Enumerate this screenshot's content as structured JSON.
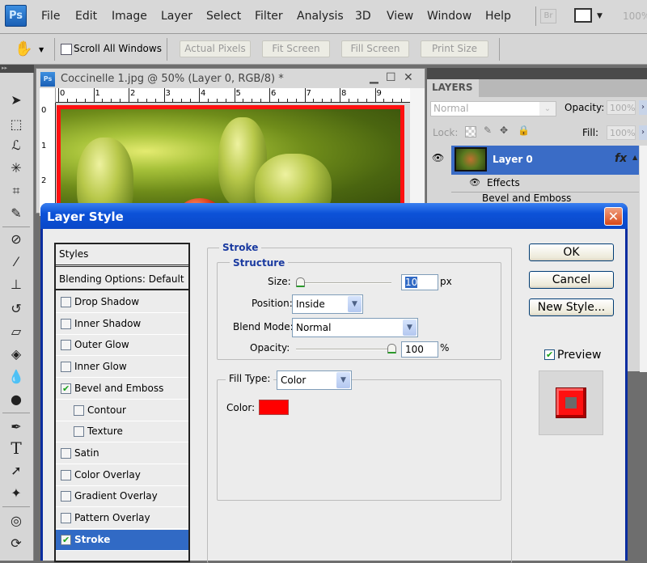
{
  "menubar": {
    "logo": "Ps",
    "items": [
      "File",
      "Edit",
      "Image",
      "Layer",
      "Select",
      "Filter",
      "Analysis",
      "3D",
      "View",
      "Window",
      "Help"
    ],
    "bridge_button": "Br",
    "zoom_level": "100%"
  },
  "options_bar": {
    "scroll_all_windows": {
      "label": "Scroll All Windows",
      "checked": false
    },
    "buttons": [
      "Actual Pixels",
      "Fit Screen",
      "Fill Screen",
      "Print Size"
    ]
  },
  "toolbar": {
    "tools": [
      "move-tool",
      "rectangular-marquee-tool",
      "lasso-tool",
      "magic-wand-tool",
      "crop-tool",
      "eyedropper-tool",
      "spot-healing-brush-tool",
      "brush-tool",
      "clone-stamp-tool",
      "history-brush-tool",
      "eraser-tool",
      "paint-bucket-tool",
      "blur-tool",
      "dodge-tool",
      "pen-tool",
      "type-tool",
      "path-selection-tool",
      "custom-shape-tool",
      "3d-rotate-tool",
      "3d-orbit-tool"
    ]
  },
  "document": {
    "title": "Coccinelle 1.jpg @ 50% (Layer 0, RGB/8) *",
    "ruler_top": [
      "0",
      "1",
      "2",
      "3",
      "4",
      "5",
      "6",
      "7",
      "8",
      "9"
    ],
    "ruler_left": [
      "0",
      "1",
      "2"
    ],
    "stroke_color": "#ff1010"
  },
  "layers_panel": {
    "tab": "LAYERS",
    "blend_mode": "Normal",
    "opacity_label": "Opacity:",
    "opacity_value": "100%",
    "lock_label": "Lock:",
    "fill_label": "Fill:",
    "fill_value": "100%",
    "layer_name": "Layer 0",
    "fx": "fx",
    "effects_label": "Effects",
    "effect_item": "Bevel and Emboss"
  },
  "dialog": {
    "title": "Layer Style",
    "styles_header": "Styles",
    "blending_options": "Blending Options: Default",
    "styles": [
      {
        "label": "Drop Shadow",
        "checked": false,
        "indent": false,
        "selected": false
      },
      {
        "label": "Inner Shadow",
        "checked": false,
        "indent": false,
        "selected": false
      },
      {
        "label": "Outer Glow",
        "checked": false,
        "indent": false,
        "selected": false
      },
      {
        "label": "Inner Glow",
        "checked": false,
        "indent": false,
        "selected": false
      },
      {
        "label": "Bevel and Emboss",
        "checked": true,
        "indent": false,
        "selected": false
      },
      {
        "label": "Contour",
        "checked": false,
        "indent": true,
        "selected": false
      },
      {
        "label": "Texture",
        "checked": false,
        "indent": true,
        "selected": false
      },
      {
        "label": "Satin",
        "checked": false,
        "indent": false,
        "selected": false
      },
      {
        "label": "Color Overlay",
        "checked": false,
        "indent": false,
        "selected": false
      },
      {
        "label": "Gradient Overlay",
        "checked": false,
        "indent": false,
        "selected": false
      },
      {
        "label": "Pattern Overlay",
        "checked": false,
        "indent": false,
        "selected": false
      },
      {
        "label": "Stroke",
        "checked": true,
        "indent": false,
        "selected": true
      }
    ],
    "stroke": {
      "group_label": "Stroke",
      "structure_label": "Structure",
      "size_label": "Size:",
      "size_value": "10",
      "size_unit": "px",
      "size_slider_fraction": 0.04,
      "position_label": "Position:",
      "position_value": "Inside",
      "blend_mode_label": "Blend Mode:",
      "blend_mode_value": "Normal",
      "opacity_label": "Opacity:",
      "opacity_value": "100",
      "opacity_unit": "%",
      "opacity_slider_fraction": 1.0,
      "fill_type_label": "Fill Type:",
      "fill_type_value": "Color",
      "color_label": "Color:",
      "color_value": "#ff0000"
    },
    "buttons": {
      "ok": "OK",
      "cancel": "Cancel",
      "new_style": "New Style..."
    },
    "preview": {
      "label": "Preview",
      "checked": true
    }
  }
}
